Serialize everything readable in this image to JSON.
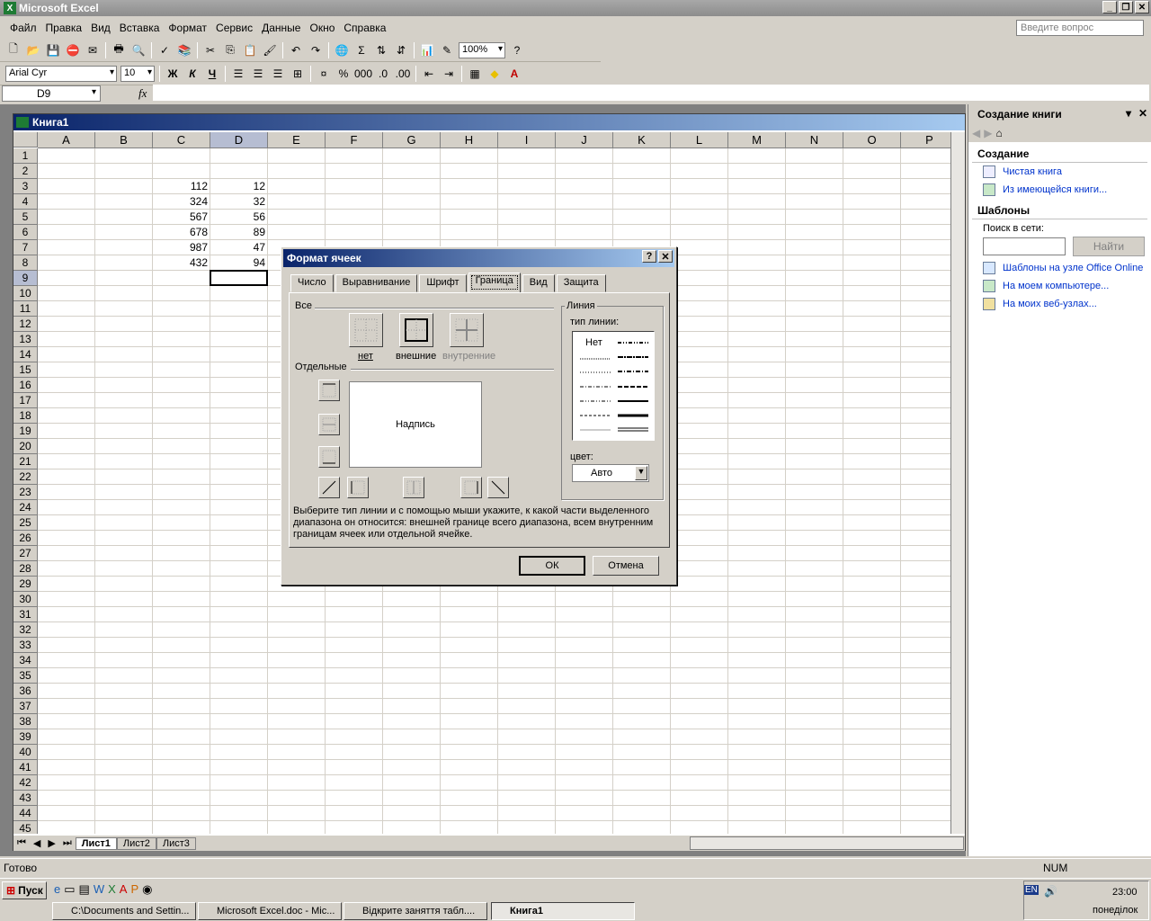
{
  "app": {
    "title": "Microsoft Excel",
    "ask_placeholder": "Введите вопрос"
  },
  "menu": [
    "Файл",
    "Правка",
    "Вид",
    "Вставка",
    "Формат",
    "Сервис",
    "Данные",
    "Окно",
    "Справка"
  ],
  "toolbar": {
    "zoom": "100%",
    "font": "Arial Cyr",
    "size": "10"
  },
  "formula": {
    "name_box": "D9",
    "fx": "fx"
  },
  "workbook": {
    "title": "Книга1",
    "columns": [
      "A",
      "B",
      "C",
      "D",
      "E",
      "F",
      "G",
      "H",
      "I",
      "J",
      "K",
      "L",
      "M",
      "N",
      "O",
      "P"
    ],
    "row_count": 45,
    "cells": [
      {
        "row": 3,
        "col": "C",
        "value": "112"
      },
      {
        "row": 3,
        "col": "D",
        "value": "12"
      },
      {
        "row": 4,
        "col": "C",
        "value": "324"
      },
      {
        "row": 4,
        "col": "D",
        "value": "32"
      },
      {
        "row": 5,
        "col": "C",
        "value": "567"
      },
      {
        "row": 5,
        "col": "D",
        "value": "56"
      },
      {
        "row": 6,
        "col": "C",
        "value": "678"
      },
      {
        "row": 6,
        "col": "D",
        "value": "89"
      },
      {
        "row": 7,
        "col": "C",
        "value": "987"
      },
      {
        "row": 7,
        "col": "D",
        "value": "47"
      },
      {
        "row": 8,
        "col": "C",
        "value": "432"
      },
      {
        "row": 8,
        "col": "D",
        "value": "94"
      }
    ],
    "sheets": [
      "Лист1",
      "Лист2",
      "Лист3"
    ],
    "active_sheet": "Лист1"
  },
  "taskpane": {
    "title": "Создание книги",
    "section_create": "Создание",
    "link_blank": "Чистая книга",
    "link_existing": "Из имеющейся книги...",
    "section_templates": "Шаблоны",
    "search_label": "Поиск в сети:",
    "search_button": "Найти",
    "link_online": "Шаблоны на узле Office Online",
    "link_computer": "На моем компьютере...",
    "link_web": "На моих веб-узлах..."
  },
  "dialog": {
    "title": "Формат ячеек",
    "tabs": [
      "Число",
      "Выравнивание",
      "Шрифт",
      "Граница",
      "Вид",
      "Защита"
    ],
    "selected_tab": "Граница",
    "group_all": "Все",
    "preset_none": "нет",
    "preset_outline": "внешние",
    "preset_inside": "внутренние",
    "group_separate": "Отдельные",
    "preview_text": "Надпись",
    "group_line": "Линия",
    "line_type_label": "тип линии:",
    "line_none": "Нет",
    "color_label": "цвет:",
    "color_value": "Авто",
    "hint": "Выберите тип линии и с помощью мыши укажите, к какой части выделенного диапазона он относится: внешней границе всего диапазона, всем внутренним границам ячеек или отдельной ячейке.",
    "ok": "ОК",
    "cancel": "Отмена"
  },
  "status": {
    "ready": "Готово",
    "num": "NUM"
  },
  "taskbar": {
    "start": "Пуск",
    "tasks": [
      "C:\\Documents and Settin...",
      "Microsoft Excel.doc - Mic...",
      "Відкрите заняття табл....",
      "Книга1"
    ],
    "lang": "EN",
    "time": "23:00",
    "day": "понеділок"
  }
}
